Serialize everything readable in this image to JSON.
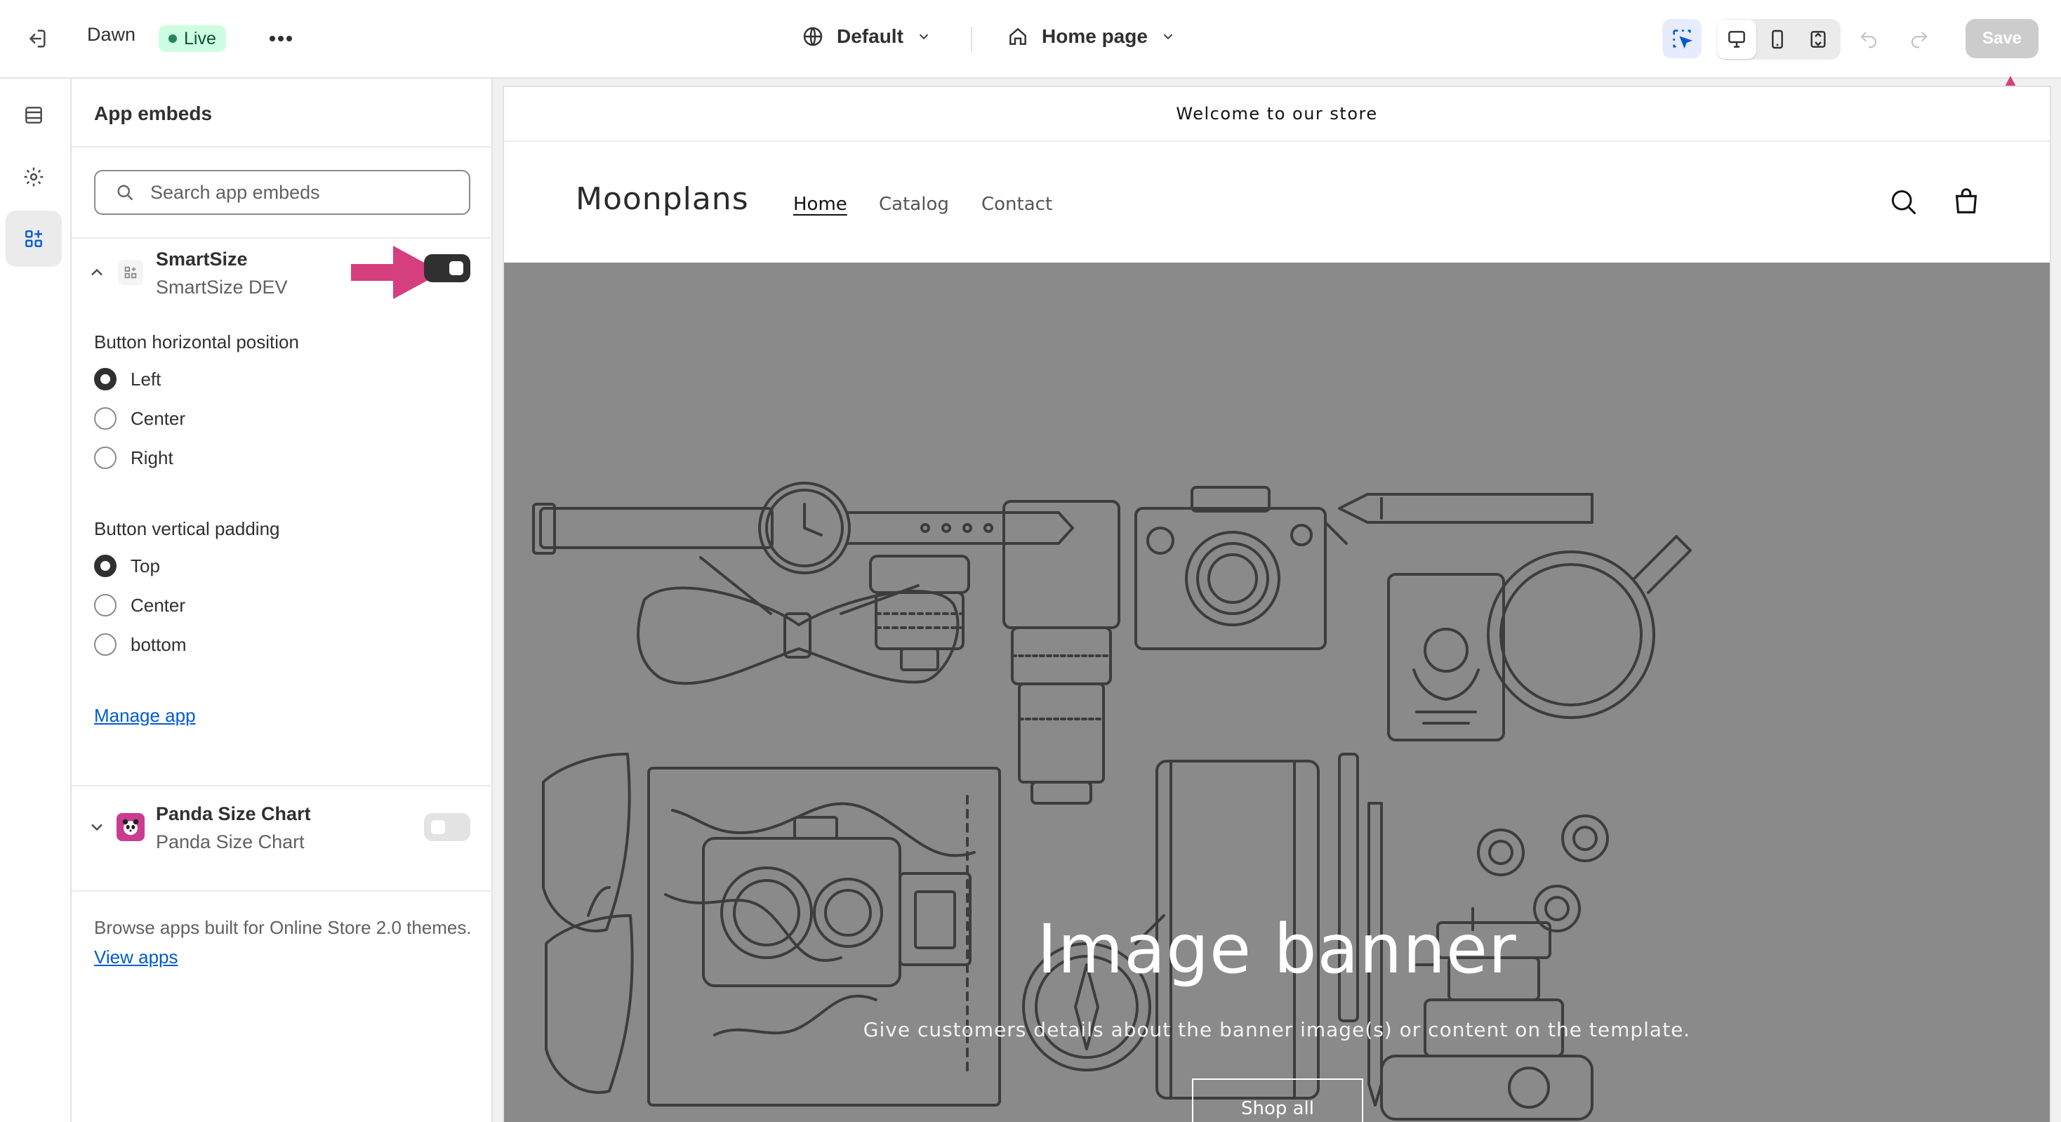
{
  "topbar": {
    "theme_name": "Dawn",
    "live_badge": "Live",
    "locale_select": "Default",
    "template_select": "Home page",
    "save_label": "Save"
  },
  "panel": {
    "title": "App embeds",
    "search_placeholder": "Search app embeds",
    "apps": [
      {
        "name": "SmartSize",
        "subtitle": "SmartSize DEV",
        "enabled": true,
        "settings": {
          "horizontal_label": "Button horizontal position",
          "horizontal_options": [
            "Left",
            "Center",
            "Right"
          ],
          "horizontal_selected": "Left",
          "vertical_label": "Button vertical padding",
          "vertical_options": [
            "Top",
            "Center",
            "bottom"
          ],
          "vertical_selected": "Top",
          "manage_link": "Manage app"
        }
      },
      {
        "name": "Panda Size Chart",
        "subtitle": "Panda Size Chart",
        "enabled": false
      }
    ],
    "footer_text": "Browse apps built for Online Store 2.0 themes.",
    "footer_link": "View apps"
  },
  "preview": {
    "announcement": "Welcome to our store",
    "store_name": "Moonplans",
    "nav": [
      "Home",
      "Catalog",
      "Contact"
    ],
    "nav_active": "Home",
    "banner_title": "Image banner",
    "banner_subtitle": "Give customers details about the banner image(s) or content on the template.",
    "banner_button": "Shop all"
  },
  "colors": {
    "annotation_arrow": "#d63f7d",
    "toggle_on": "#303030",
    "toggle_off": "#e3e3e3",
    "link": "#005bd3",
    "live_badge_bg": "#cdfee1",
    "banner_bg": "#8a8a8a"
  }
}
